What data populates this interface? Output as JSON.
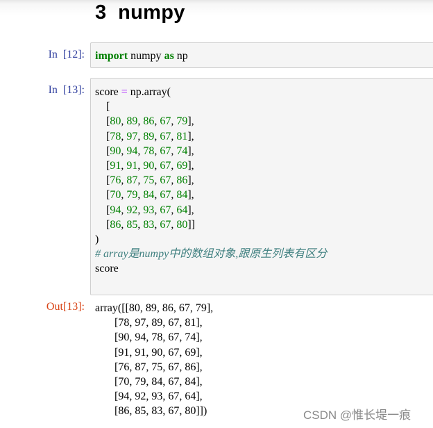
{
  "notebook": {
    "heading": "3  numpy",
    "cells": [
      {
        "prompt": "In  [12]:",
        "code": {
          "keyword_import": "import",
          "module": " numpy ",
          "keyword_as": "as",
          "alias": " np"
        }
      },
      {
        "prompt": "In  [13]:",
        "code": {
          "line1_var": "score ",
          "line1_op": "=",
          "line1_call": " np.array(",
          "open_bracket": "    [",
          "rows": [
            [
              80,
              89,
              86,
              67,
              79
            ],
            [
              78,
              97,
              89,
              67,
              81
            ],
            [
              90,
              94,
              78,
              67,
              74
            ],
            [
              91,
              91,
              90,
              67,
              69
            ],
            [
              76,
              87,
              75,
              67,
              86
            ],
            [
              70,
              79,
              84,
              67,
              84
            ],
            [
              94,
              92,
              93,
              67,
              64
            ],
            [
              86,
              85,
              83,
              67,
              80
            ]
          ],
          "close_paren": ")",
          "comment": "# array是numpy中的数组对象,跟原生列表有区分",
          "last_line": "score"
        }
      }
    ],
    "output": {
      "prompt": "Out[13]:",
      "lines": [
        "array([[80, 89, 86, 67, 79],",
        "       [78, 97, 89, 67, 81],",
        "       [90, 94, 78, 67, 74],",
        "       [91, 91, 90, 67, 69],",
        "       [76, 87, 75, 67, 86],",
        "       [70, 79, 84, 67, 84],",
        "       [94, 92, 93, 67, 64],",
        "       [86, 85, 83, 67, 80]])"
      ]
    }
  },
  "watermark": "CSDN @惟长堤一痕",
  "colors": {
    "in_prompt": "#303f9f",
    "out_prompt": "#d84315",
    "keyword": "#008000",
    "number": "#008000",
    "operator": "#aa22ff",
    "comment": "#408080",
    "cell_bg": "#f5f5f5"
  }
}
